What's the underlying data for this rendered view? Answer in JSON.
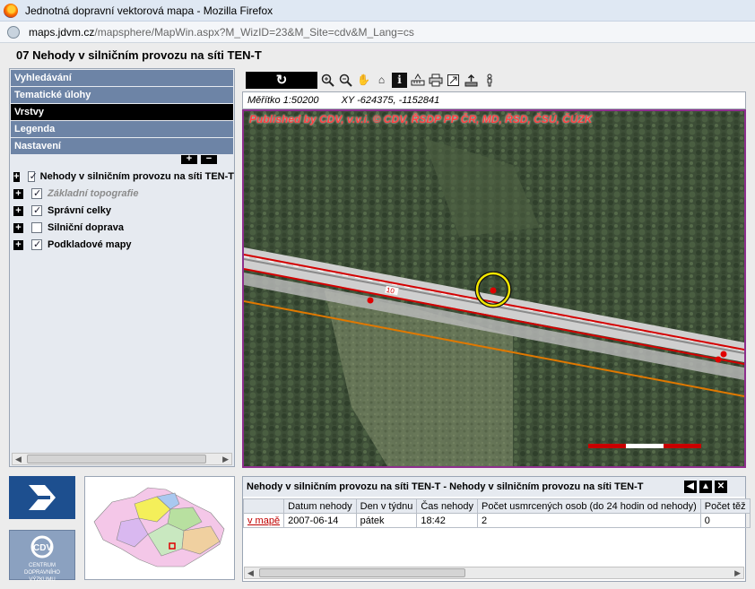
{
  "window": {
    "title": "Jednotná dopravní vektorová mapa - Mozilla Firefox"
  },
  "urlbar": {
    "host": "maps.jdvm.cz",
    "path": "/mapsphere/MapWin.aspx?M_WizID=23&M_Site=cdv&M_Lang=cs"
  },
  "page": {
    "title": "07 Nehody v silničním provozu na síti TEN-T"
  },
  "menu": [
    {
      "label": "Vyhledávání"
    },
    {
      "label": "Tematické úlohy"
    },
    {
      "label": "Vrstvy"
    },
    {
      "label": "Legenda"
    },
    {
      "label": "Nastavení"
    }
  ],
  "layers": [
    {
      "label": "Nehody v silničním provozu na síti TEN-T",
      "checked": true
    },
    {
      "label": "Základní topografie",
      "checked": true
    },
    {
      "label": "Správní celky",
      "checked": true
    },
    {
      "label": "Silniční doprava",
      "checked": false
    },
    {
      "label": "Podkladové mapy",
      "checked": true
    }
  ],
  "toolbar": {
    "reload": "↻",
    "tools": [
      "zoom-in-icon",
      "zoom-out-icon",
      "pan-hand-icon",
      "home-icon",
      "info-icon",
      "measure-icon",
      "print-icon",
      "export-icon",
      "upload-icon",
      "person-icon"
    ]
  },
  "scale": {
    "label": "Měřítko 1:50200",
    "xy": "XY -624375, -1152841"
  },
  "map": {
    "credits": "Published by CDV, v.v.i. © CDV, ŘSDP PP ČR, MD, ŘSD, ČSÚ, ČÚZK",
    "road_label": "10"
  },
  "results": {
    "title": "Nehody v silničním provozu na síti TEN-T - Nehody v silničním provozu na síti TEN-T",
    "columns": [
      "",
      "Datum nehody",
      "Den v týdnu",
      "Čas nehody",
      "Počet usmrcených osob (do 24 hodin od nehody)",
      "Počet těž"
    ],
    "rows": [
      [
        "v mapě",
        "2007-06-14",
        "pátek",
        "18:42",
        "2",
        "0"
      ]
    ]
  },
  "logo": {
    "cdv_text": "CENTRUM DOPRAVNÍHO VÝZKUMU"
  }
}
